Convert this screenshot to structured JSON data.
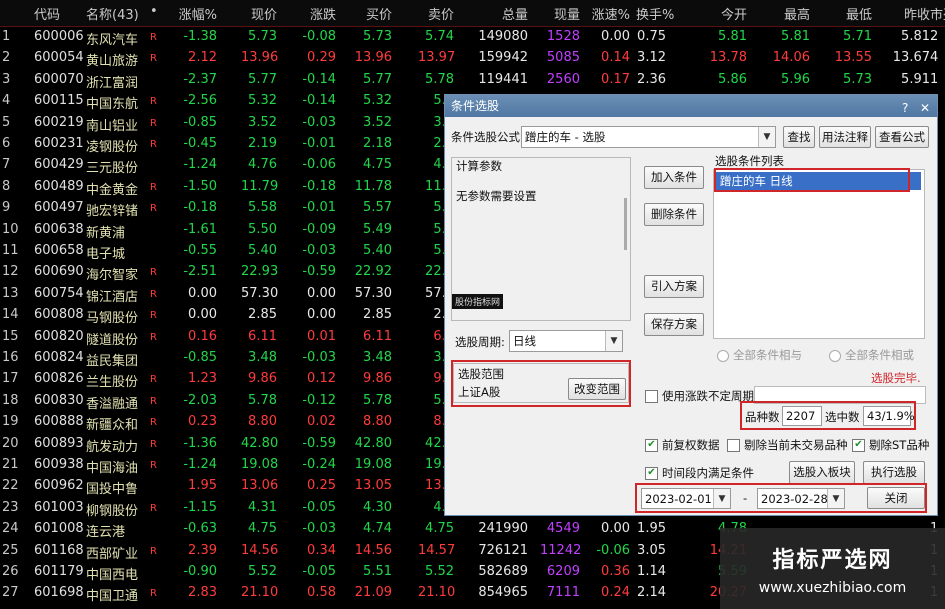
{
  "columns": [
    "",
    "代码",
    "名称(43)",
    "•",
    "涨幅%",
    "现价",
    "涨跌",
    "买价",
    "卖价",
    "总量",
    "现量",
    "涨速%",
    "换手%",
    "今开",
    "最高",
    "最低",
    "昨收",
    "市盈"
  ],
  "rows": [
    {
      "n": "1",
      "code": "600006",
      "name": "东风汽车",
      "flag": "R",
      "chg": "-1.38",
      "price": "5.73",
      "delta": "-0.08",
      "bid": "5.73",
      "ask": "5.74",
      "vol": "149080",
      "cur": "1528",
      "speed": "0.00",
      "turn": "0.75",
      "open": "5.81",
      "high": "5.81",
      "low": "5.71",
      "prev": "5.81",
      "pe": "2"
    },
    {
      "n": "2",
      "code": "600054",
      "name": "黄山旅游",
      "flag": "R",
      "chg": "2.12",
      "price": "13.96",
      "delta": "0.29",
      "bid": "13.96",
      "ask": "13.97",
      "vol": "159942",
      "cur": "5085",
      "speed": "0.14",
      "turn": "3.12",
      "open": "13.78",
      "high": "14.06",
      "low": "13.55",
      "prev": "13.67",
      "pe": "4"
    },
    {
      "n": "3",
      "code": "600070",
      "name": "浙江富润",
      "flag": "",
      "chg": "-2.37",
      "price": "5.77",
      "delta": "-0.14",
      "bid": "5.77",
      "ask": "5.78",
      "vol": "119441",
      "cur": "2560",
      "speed": "0.17",
      "turn": "2.36",
      "open": "5.86",
      "high": "5.96",
      "low": "5.73",
      "prev": "5.91",
      "pe": "1"
    },
    {
      "n": "4",
      "code": "600115",
      "name": "中国东航",
      "flag": "R",
      "chg": "-2.56",
      "price": "5.32",
      "delta": "-0.14",
      "bid": "5.32",
      "ask": "5.3",
      "vol": "",
      "cur": "",
      "speed": "",
      "turn": "",
      "open": "",
      "high": "",
      "low": "",
      "prev": "",
      "pe": "0"
    },
    {
      "n": "5",
      "code": "600219",
      "name": "南山铝业",
      "flag": "R",
      "chg": "-0.85",
      "price": "3.52",
      "delta": "-0.03",
      "bid": "3.52",
      "ask": "3.5",
      "vol": "",
      "cur": "",
      "speed": "",
      "turn": "",
      "open": "",
      "high": "",
      "low": "",
      "prev": "",
      "pe": "1"
    },
    {
      "n": "6",
      "code": "600231",
      "name": "凌钢股份",
      "flag": "R",
      "chg": "-0.45",
      "price": "2.19",
      "delta": "-0.01",
      "bid": "2.18",
      "ask": "2.1",
      "vol": "",
      "cur": "",
      "speed": "",
      "turn": "",
      "open": "",
      "high": "",
      "low": "",
      "prev": "",
      "pe": "7"
    },
    {
      "n": "7",
      "code": "600429",
      "name": "三元股份",
      "flag": "",
      "chg": "-1.24",
      "price": "4.76",
      "delta": "-0.06",
      "bid": "4.75",
      "ask": "4.7",
      "vol": "",
      "cur": "",
      "speed": "",
      "turn": "",
      "open": "",
      "high": "",
      "low": "",
      "prev": "",
      "pe": "9"
    },
    {
      "n": "8",
      "code": "600489",
      "name": "中金黄金",
      "flag": "R",
      "chg": "-1.50",
      "price": "11.79",
      "delta": "-0.18",
      "bid": "11.78",
      "ask": "11.7",
      "vol": "",
      "cur": "",
      "speed": "",
      "turn": "",
      "open": "",
      "high": "",
      "low": "",
      "prev": "",
      "pe": "2"
    },
    {
      "n": "9",
      "code": "600497",
      "name": "驰宏锌锗",
      "flag": "R",
      "chg": "-0.18",
      "price": "5.58",
      "delta": "-0.01",
      "bid": "5.57",
      "ask": "5.5",
      "vol": "",
      "cur": "",
      "speed": "",
      "turn": "",
      "open": "",
      "high": "",
      "low": "",
      "prev": "",
      "pe": "1"
    },
    {
      "n": "10",
      "code": "600638",
      "name": "新黄浦",
      "flag": "",
      "chg": "-1.61",
      "price": "5.50",
      "delta": "-0.09",
      "bid": "5.49",
      "ask": "5.5",
      "vol": "",
      "cur": "",
      "speed": "",
      "turn": "",
      "open": "",
      "high": "",
      "low": "",
      "prev": "",
      "pe": "1"
    },
    {
      "n": "11",
      "code": "600658",
      "name": "电子城",
      "flag": "",
      "chg": "-0.55",
      "price": "5.40",
      "delta": "-0.03",
      "bid": "5.40",
      "ask": "5.4",
      "vol": "",
      "cur": "",
      "speed": "",
      "turn": "",
      "open": "",
      "high": "",
      "low": "",
      "prev": "",
      "pe": "1"
    },
    {
      "n": "12",
      "code": "600690",
      "name": "海尔智家",
      "flag": "R",
      "chg": "-2.51",
      "price": "22.93",
      "delta": "-0.59",
      "bid": "22.92",
      "ask": "22.9",
      "vol": "",
      "cur": "",
      "speed": "",
      "turn": "",
      "open": "",
      "high": "",
      "low": "",
      "prev": "",
      "pe": "0"
    },
    {
      "n": "13",
      "code": "600754",
      "name": "锦江酒店",
      "flag": "R",
      "chg": "0.00",
      "price": "57.30",
      "delta": "0.00",
      "bid": "57.30",
      "ask": "57.3",
      "vol": "",
      "cur": "",
      "speed": "",
      "turn": "",
      "open": "",
      "high": "",
      "low": "",
      "prev": "",
      "pe": "1"
    },
    {
      "n": "14",
      "code": "600808",
      "name": "马钢股份",
      "flag": "R",
      "chg": "0.00",
      "price": "2.85",
      "delta": "0.00",
      "bid": "2.85",
      "ask": "2.8",
      "vol": "",
      "cur": "",
      "speed": "",
      "turn": "",
      "open": "",
      "high": "",
      "low": "",
      "prev": "",
      "pe": "8"
    },
    {
      "n": "15",
      "code": "600820",
      "name": "隧道股份",
      "flag": "R",
      "chg": "0.16",
      "price": "6.11",
      "delta": "0.01",
      "bid": "6.11",
      "ask": "6.1",
      "vol": "",
      "cur": "",
      "speed": "",
      "turn": "",
      "open": "",
      "high": "",
      "low": "",
      "prev": "",
      "pe": "1"
    },
    {
      "n": "16",
      "code": "600824",
      "name": "益民集团",
      "flag": "",
      "chg": "-0.85",
      "price": "3.48",
      "delta": "-0.03",
      "bid": "3.48",
      "ask": "3.4",
      "vol": "",
      "cur": "",
      "speed": "",
      "turn": "",
      "open": "",
      "high": "",
      "low": "",
      "prev": "",
      "pe": "1"
    },
    {
      "n": "17",
      "code": "600826",
      "name": "兰生股份",
      "flag": "R",
      "chg": "1.23",
      "price": "9.86",
      "delta": "0.12",
      "bid": "9.86",
      "ask": "9.8",
      "vol": "",
      "cur": "",
      "speed": "",
      "turn": "",
      "open": "",
      "high": "",
      "low": "",
      "prev": "",
      "pe": "1"
    },
    {
      "n": "18",
      "code": "600830",
      "name": "香溢融通",
      "flag": "R",
      "chg": "-2.03",
      "price": "5.78",
      "delta": "-0.12",
      "bid": "5.78",
      "ask": "5.7",
      "vol": "",
      "cur": "",
      "speed": "",
      "turn": "",
      "open": "",
      "high": "",
      "low": "",
      "prev": "",
      "pe": "1"
    },
    {
      "n": "19",
      "code": "600888",
      "name": "新疆众和",
      "flag": "R",
      "chg": "0.23",
      "price": "8.80",
      "delta": "0.02",
      "bid": "8.80",
      "ask": "8.8",
      "vol": "",
      "cur": "",
      "speed": "",
      "turn": "",
      "open": "",
      "high": "",
      "low": "",
      "prev": "",
      "pe": "1"
    },
    {
      "n": "20",
      "code": "600893",
      "name": "航发动力",
      "flag": "R",
      "chg": "-1.36",
      "price": "42.80",
      "delta": "-0.59",
      "bid": "42.80",
      "ask": "42.8",
      "vol": "",
      "cur": "",
      "speed": "",
      "turn": "",
      "open": "",
      "high": "",
      "low": "",
      "prev": "",
      "pe": "1"
    },
    {
      "n": "21",
      "code": "600938",
      "name": "中国海油",
      "flag": "R",
      "chg": "-1.24",
      "price": "19.08",
      "delta": "-0.24",
      "bid": "19.08",
      "ask": "19.0",
      "vol": "",
      "cur": "",
      "speed": "",
      "turn": "",
      "open": "",
      "high": "",
      "low": "",
      "prev": "",
      "pe": "1"
    },
    {
      "n": "22",
      "code": "600962",
      "name": "国投中鲁",
      "flag": "",
      "chg": "1.95",
      "price": "13.06",
      "delta": "0.25",
      "bid": "13.05",
      "ask": "13.0",
      "vol": "",
      "cur": "",
      "speed": "",
      "turn": "",
      "open": "",
      "high": "",
      "low": "",
      "prev": "",
      "pe": "1"
    },
    {
      "n": "23",
      "code": "601003",
      "name": "柳钢股份",
      "flag": "R",
      "chg": "-1.15",
      "price": "4.31",
      "delta": "-0.05",
      "bid": "4.30",
      "ask": "4.3",
      "vol": "",
      "cur": "",
      "speed": "",
      "turn": "",
      "open": "",
      "high": "",
      "low": "",
      "prev": "",
      "pe": "1"
    },
    {
      "n": "24",
      "code": "601008",
      "name": "连云港",
      "flag": "",
      "chg": "-0.63",
      "price": "4.75",
      "delta": "-0.03",
      "bid": "4.74",
      "ask": "4.75",
      "vol": "241990",
      "cur": "4549",
      "speed": "0.00",
      "turn": "1.95",
      "open": "4.78",
      "high": "",
      "low": "",
      "prev": "",
      "pe": "1"
    },
    {
      "n": "25",
      "code": "601168",
      "name": "西部矿业",
      "flag": "R",
      "chg": "2.39",
      "price": "14.56",
      "delta": "0.34",
      "bid": "14.56",
      "ask": "14.57",
      "vol": "726121",
      "cur": "11242",
      "speed": "-0.06",
      "turn": "3.05",
      "open": "14.21",
      "high": "",
      "low": "",
      "prev": "",
      "pe": "1"
    },
    {
      "n": "26",
      "code": "601179",
      "name": "中国西电",
      "flag": "",
      "chg": "-0.90",
      "price": "5.52",
      "delta": "-0.05",
      "bid": "5.51",
      "ask": "5.52",
      "vol": "582689",
      "cur": "6209",
      "speed": "0.36",
      "turn": "1.14",
      "open": "5.59",
      "high": "",
      "low": "",
      "prev": "",
      "pe": "1"
    },
    {
      "n": "27",
      "code": "601698",
      "name": "中国卫通",
      "flag": "R",
      "chg": "2.83",
      "price": "21.10",
      "delta": "0.58",
      "bid": "21.09",
      "ask": "21.10",
      "vol": "854965",
      "cur": "7111",
      "speed": "0.24",
      "turn": "2.14",
      "open": "20.27",
      "high": "",
      "low": "",
      "prev": "",
      "pe": "1"
    }
  ],
  "dialog": {
    "title": "条件选股",
    "formula_label": "条件选股公式",
    "formula_value": "蹭庄的车 - 选股",
    "btn_query": "查找",
    "btn_usage": "用法注释",
    "btn_view": "查看公式",
    "calc_params_title": "计算参数",
    "no_params_text": "无参数需要设置",
    "index_tag": "股份指标网",
    "btn_add": "加入条件",
    "btn_delete": "删除条件",
    "condition_list_title": "选股条件列表",
    "condition_item": "蹭庄的车  日线",
    "btn_import": "引入方案",
    "btn_save": "保存方案",
    "period_label": "选股周期:",
    "period_value": "日线",
    "radio_and": "全部条件相与",
    "radio_or": "全部条件相或",
    "scope_title": "选股范围",
    "scope_value": "上证A股",
    "btn_change_scope": "改变范围",
    "done_text": "选股完毕.",
    "use_uncertain_period": "使用涨跌不定周期",
    "count_label": "品种数",
    "count_value": "2207",
    "selected_label": "选中数",
    "selected_value": "43/1.9%",
    "chk_preadjust": "前复权数据",
    "chk_exclude_untraded": "剔除当前未交易品种",
    "chk_exclude_st": "剔除ST品种",
    "chk_time_range": "时间段内满足条件",
    "btn_to_board": "选股入板块",
    "btn_execute": "执行选股",
    "date_from": "2023-02-01",
    "date_sep": "-",
    "date_to": "2023-02-28",
    "btn_close": "关闭"
  },
  "watermark": {
    "title": "指标严选网",
    "url": "www.xuezhibiao.com"
  },
  "colors": {
    "up": "#ff3c3c",
    "down": "#22d64a",
    "neutral": "#e8e8e8",
    "code": "#e0e0e0",
    "name": "#e0e0b0",
    "vol": "#e8e8e8",
    "cur": "#c040ff",
    "flag": "#ff3c3c",
    "accent": "#d0262a",
    "selection": "#3a6fc8"
  }
}
